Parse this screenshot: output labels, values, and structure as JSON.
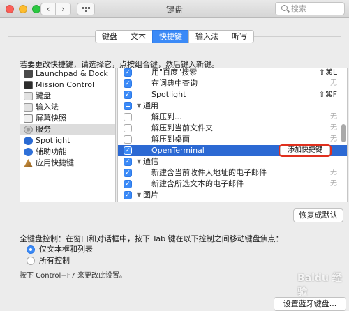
{
  "window": {
    "title": "键盘"
  },
  "search": {
    "placeholder": "搜索"
  },
  "tabs": [
    {
      "label": "键盘",
      "active": false
    },
    {
      "label": "文本",
      "active": false
    },
    {
      "label": "快捷键",
      "active": true
    },
    {
      "label": "输入法",
      "active": false
    },
    {
      "label": "听写",
      "active": false
    }
  ],
  "instruction": "若要更改快捷键，请选择它，点按组合键，然后键入新键。",
  "categories": [
    {
      "label": "Launchpad & Dock",
      "icon": "launchpad-icon"
    },
    {
      "label": "Mission Control",
      "icon": "mission-control-icon"
    },
    {
      "label": "键盘",
      "icon": "keyboard-icon"
    },
    {
      "label": "输入法",
      "icon": "input-source-icon"
    },
    {
      "label": "屏幕快照",
      "icon": "screenshot-icon"
    },
    {
      "label": "服务",
      "icon": "services-gear-icon",
      "selected": true
    },
    {
      "label": "Spotlight",
      "icon": "spotlight-icon"
    },
    {
      "label": "辅助功能",
      "icon": "accessibility-icon"
    },
    {
      "label": "应用快捷键",
      "icon": "app-shortcuts-icon"
    }
  ],
  "shortcuts": [
    {
      "label": "用\"百度\"搜索",
      "checked": true,
      "shortcut": "⇧⌘L"
    },
    {
      "label": "在词典中查询",
      "checked": true,
      "shortcut": "无"
    },
    {
      "label": "Spotlight",
      "checked": true,
      "shortcut": "⇧⌘F"
    },
    {
      "label": "通用",
      "group": true,
      "mixed": true
    },
    {
      "label": "解压到...",
      "checked": false,
      "shortcut": "无"
    },
    {
      "label": "解压到当前文件夹",
      "checked": false,
      "shortcut": "无"
    },
    {
      "label": "解压到桌面",
      "checked": false,
      "shortcut": "无"
    },
    {
      "label": "OpenTerminal",
      "checked": true,
      "selected": true,
      "button": "添加快捷键"
    },
    {
      "label": "通信",
      "group": true,
      "checked": true
    },
    {
      "label": "新建含当前收件人地址的电子邮件",
      "checked": true,
      "shortcut": "无"
    },
    {
      "label": "新建含所选文本的电子邮件",
      "checked": true,
      "shortcut": "无"
    },
    {
      "label": "图片",
      "group": true,
      "checked": true
    }
  ],
  "restore_label": "恢复成默认",
  "full_keyboard": {
    "text": "全键盘控制：在窗口和对话框中，按下 Tab 键在以下控制之间移动键盘焦点：",
    "options": [
      {
        "label": "仅文本框和列表",
        "selected": true
      },
      {
        "label": "所有控制",
        "selected": false
      }
    ],
    "hint": "按下 Control+F7 来更改此设置。"
  },
  "bluetooth_label": "设置蓝牙键盘...",
  "watermark": "Baidu 经验",
  "colors": {
    "accent": "#3b8af7",
    "selection": "#2c69d3",
    "highlight_ring": "#e0301e"
  }
}
